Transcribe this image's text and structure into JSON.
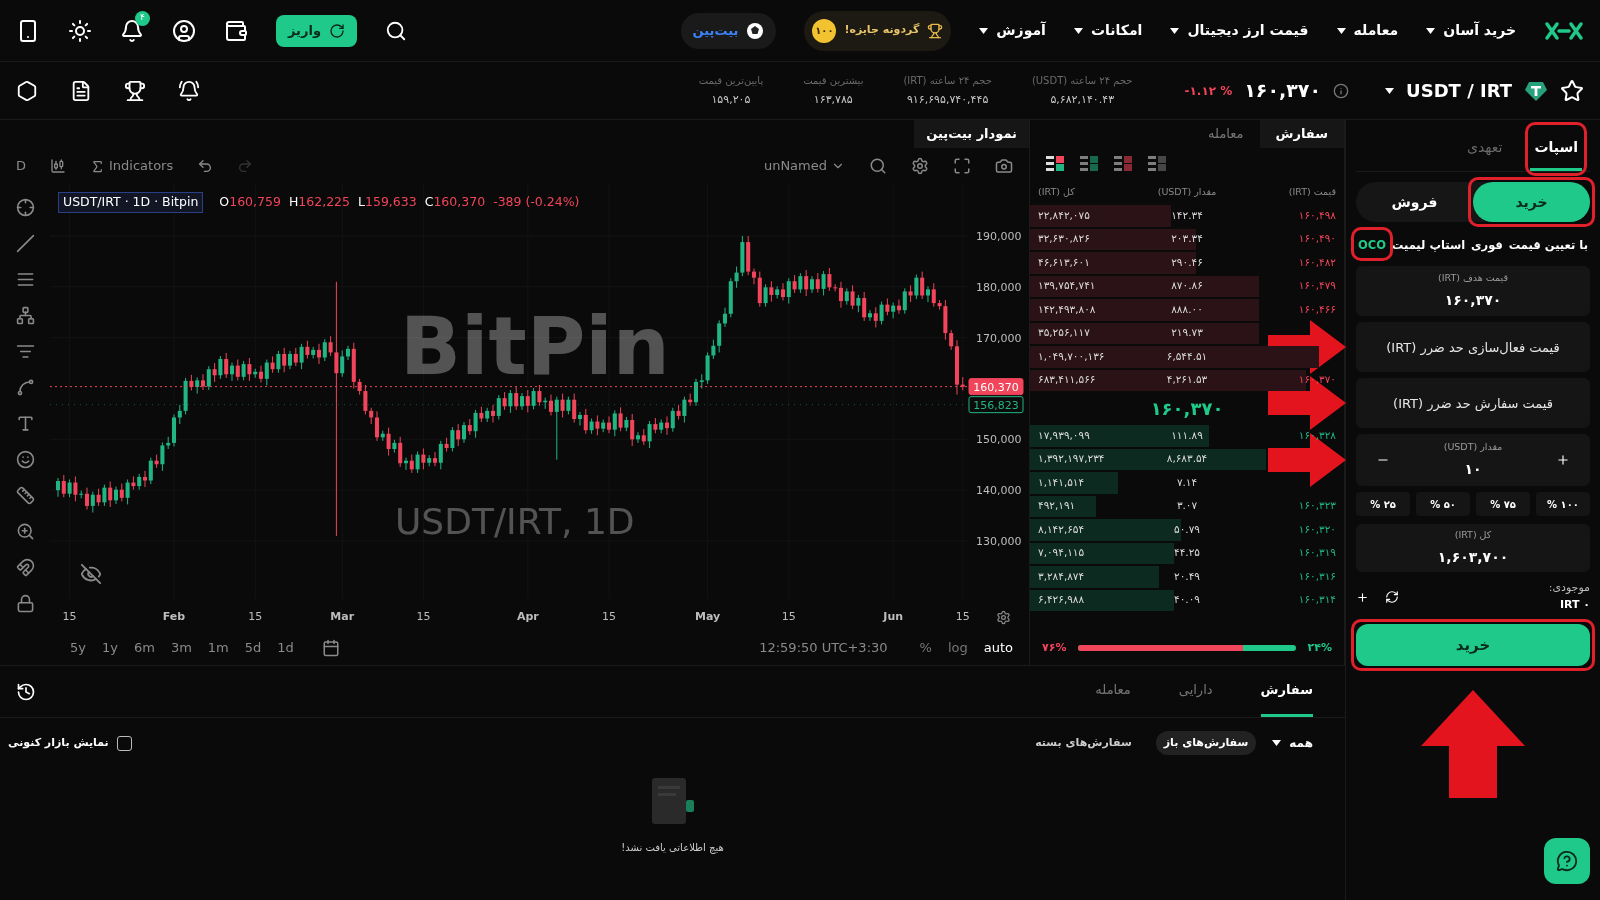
{
  "top_nav": {
    "menu": [
      {
        "label": "خرید آسان"
      },
      {
        "label": "معامله"
      },
      {
        "label": "قیمت ارز دیجیتال"
      },
      {
        "label": "امکانات"
      },
      {
        "label": "آموزش"
      }
    ],
    "prize": {
      "label": "گردونه جایزه!",
      "coin": "۱۰۰"
    },
    "brand_pill": "بیت‌پین",
    "deposit_button": "واریز",
    "notification_count": "۴"
  },
  "market_bar": {
    "pair": "USDT / IRT",
    "favorite": false,
    "price": "۱۶۰,۳۷۰",
    "change": "-۱.۱۲ %",
    "stats": [
      {
        "label": "حجم ۲۴ ساعته (USDT)",
        "value": "۵,۶۸۲,۱۴۰.۴۳"
      },
      {
        "label": "حجم ۲۴ ساعته (IRT)",
        "value": "۹۱۶,۶۹۵,۷۴۰,۴۴۵"
      },
      {
        "label": "بیشترین قیمت",
        "value": "۱۶۳,۷۸۵"
      },
      {
        "label": "پایین‌ترین قیمت",
        "value": "۱۵۹,۲۰۵"
      }
    ]
  },
  "chart": {
    "tab": "نمودار بیت‌پین",
    "interval": "D",
    "indicators_label": "Indicators",
    "layout_name": "unNamed",
    "legend": {
      "symbol": "USDT/IRT · 1D · Bitpin",
      "ohlc": [
        {
          "key": "C",
          "value": "160,370"
        },
        {
          "key": "L",
          "value": "159,633"
        },
        {
          "key": "H",
          "value": "162,225"
        },
        {
          "key": "O",
          "value": "160,759"
        }
      ],
      "change": "-389 (-0.24%)"
    },
    "watermark": [
      "BitPin",
      "USDT/IRT, 1D"
    ],
    "chart_data": {
      "type": "candlestick",
      "categories": [
        null,
        null,
        "15",
        null,
        null,
        null,
        null,
        null,
        null,
        null,
        null,
        null,
        null,
        null,
        null,
        null,
        null,
        null,
        null,
        null,
        "Feb",
        null,
        null,
        null,
        null,
        null,
        null,
        null,
        null,
        null,
        null,
        null,
        null,
        null,
        "15",
        null,
        null,
        null,
        null,
        null,
        null,
        null,
        null,
        null,
        null,
        null,
        null,
        null,
        null,
        "Mar",
        null,
        null,
        null,
        null,
        null,
        null,
        null,
        null,
        null,
        null,
        null,
        null,
        null,
        "15",
        null,
        null,
        null,
        null,
        null,
        null,
        null,
        null,
        null,
        null,
        null,
        null,
        null,
        null,
        null,
        null,
        null,
        "Apr",
        null,
        null,
        null,
        null,
        null,
        null,
        null,
        null,
        null,
        null,
        null,
        null,
        null,
        "15",
        null,
        null,
        null,
        null,
        null,
        null,
        null,
        null,
        null,
        null,
        null,
        null,
        null,
        null,
        null,
        null,
        "May",
        null,
        null,
        null,
        null,
        null,
        null,
        null,
        null,
        null,
        null,
        null,
        null,
        null,
        "15",
        null,
        null,
        null,
        null,
        null,
        null,
        null,
        null,
        null,
        null,
        null,
        null,
        null,
        null,
        null,
        null,
        null,
        "Jun",
        null,
        null,
        null,
        null,
        null,
        null,
        null,
        null,
        null,
        null,
        null,
        "15"
      ],
      "ohlc": [
        [
          140000,
          142400,
          138700,
          141800
        ],
        [
          141800,
          143000,
          138600,
          139300
        ],
        [
          139300,
          142100,
          138600,
          141500
        ],
        [
          141500,
          142700,
          137800,
          139100
        ],
        [
          139100,
          139900,
          138400,
          139300
        ],
        [
          139300,
          140500,
          136200,
          136900
        ],
        [
          136900,
          139700,
          135600,
          139100
        ],
        [
          139100,
          140300,
          136900,
          137600
        ],
        [
          137600,
          141100,
          136900,
          140500
        ],
        [
          140500,
          141700,
          136700,
          138000
        ],
        [
          138000,
          140700,
          137300,
          140100
        ],
        [
          140100,
          141300,
          137800,
          138500
        ],
        [
          138500,
          142100,
          137200,
          141500
        ],
        [
          141500,
          142700,
          140100,
          140800
        ],
        [
          140800,
          143200,
          140100,
          142600
        ],
        [
          142600,
          143800,
          140600,
          141900
        ],
        [
          141900,
          146400,
          141200,
          145800
        ],
        [
          145800,
          147000,
          144400,
          145100
        ],
        [
          145100,
          149400,
          143800,
          148800
        ],
        [
          148800,
          150500,
          148100,
          149300
        ],
        [
          149300,
          154900,
          148600,
          154300
        ],
        [
          154300,
          156800,
          153000,
          155600
        ],
        [
          155600,
          162100,
          154900,
          161500
        ],
        [
          161500,
          162700,
          159600,
          160300
        ],
        [
          160300,
          162200,
          159000,
          161600
        ],
        [
          161600,
          162800,
          159700,
          160400
        ],
        [
          160400,
          164400,
          159700,
          163800
        ],
        [
          163800,
          165000,
          161300,
          162600
        ],
        [
          162600,
          166400,
          161900,
          165800
        ],
        [
          165800,
          167000,
          162100,
          162800
        ],
        [
          162800,
          165100,
          161500,
          164500
        ],
        [
          164500,
          165700,
          161600,
          162300
        ],
        [
          162300,
          165400,
          161600,
          164800
        ],
        [
          164800,
          166000,
          161500,
          162800
        ],
        [
          162800,
          163900,
          162100,
          163300
        ],
        [
          163300,
          164500,
          161200,
          161900
        ],
        [
          161900,
          165700,
          160600,
          165100
        ],
        [
          165100,
          166300,
          163100,
          163800
        ],
        [
          163800,
          167400,
          163100,
          166800
        ],
        [
          166800,
          168000,
          163200,
          164500
        ],
        [
          164500,
          167400,
          163800,
          166800
        ],
        [
          166800,
          168000,
          164400,
          165100
        ],
        [
          165100,
          168800,
          163800,
          168200
        ],
        [
          168200,
          169400,
          165900,
          166600
        ],
        [
          166600,
          168200,
          165900,
          167600
        ],
        [
          167600,
          168800,
          164800,
          166100
        ],
        [
          166100,
          169700,
          165400,
          169100
        ],
        [
          169100,
          170300,
          166400,
          167100
        ],
        [
          167100,
          181000,
          131000,
          163000
        ],
        [
          163000,
          167500,
          162300,
          166300
        ],
        [
          166300,
          168400,
          165600,
          167800
        ],
        [
          167800,
          169000,
          160000,
          161300
        ],
        [
          161300,
          161900,
          158800,
          159500
        ],
        [
          159500,
          160700,
          154900,
          155600
        ],
        [
          155600,
          156200,
          153000,
          154300
        ],
        [
          154300,
          155500,
          149700,
          150400
        ],
        [
          150400,
          151700,
          149700,
          151100
        ],
        [
          151100,
          152300,
          146800,
          148100
        ],
        [
          148100,
          149900,
          147400,
          149300
        ],
        [
          149300,
          150500,
          144600,
          145300
        ],
        [
          145300,
          146400,
          144000,
          145800
        ],
        [
          145800,
          147000,
          143400,
          144100
        ],
        [
          144100,
          147600,
          143400,
          147000
        ],
        [
          147000,
          148200,
          144100,
          145400
        ],
        [
          145400,
          146900,
          144700,
          146300
        ],
        [
          146300,
          147500,
          144700,
          145400
        ],
        [
          145400,
          149700,
          144100,
          149100
        ],
        [
          149100,
          150300,
          147600,
          148300
        ],
        [
          148300,
          152400,
          147600,
          151800
        ],
        [
          151800,
          153000,
          148700,
          150000
        ],
        [
          150000,
          153400,
          149300,
          152800
        ],
        [
          152800,
          154000,
          150900,
          151600
        ],
        [
          151600,
          155800,
          150300,
          155200
        ],
        [
          155200,
          156400,
          153400,
          154100
        ],
        [
          154100,
          156200,
          153400,
          155600
        ],
        [
          155600,
          156800,
          153300,
          154600
        ],
        [
          154600,
          158700,
          153900,
          158100
        ],
        [
          158100,
          159300,
          155800,
          156500
        ],
        [
          156500,
          159700,
          155200,
          159100
        ],
        [
          159100,
          160300,
          155800,
          156500
        ],
        [
          156500,
          159100,
          155800,
          158500
        ],
        [
          158500,
          159700,
          155300,
          156600
        ],
        [
          156600,
          160100,
          155900,
          159500
        ],
        [
          159500,
          160700,
          156600,
          157300
        ],
        [
          157300,
          158200,
          156000,
          157600
        ],
        [
          157600,
          158800,
          154700,
          155400
        ],
        [
          155400,
          158400,
          146000,
          157800
        ],
        [
          157800,
          159000,
          154300,
          155600
        ],
        [
          155600,
          158400,
          154900,
          157800
        ],
        [
          157800,
          159000,
          153300,
          154000
        ],
        [
          154000,
          155400,
          152700,
          154800
        ],
        [
          154800,
          156000,
          151100,
          151800
        ],
        [
          151800,
          154100,
          151100,
          153500
        ],
        [
          153500,
          154700,
          150800,
          152100
        ],
        [
          152100,
          153900,
          151400,
          153300
        ],
        [
          153300,
          154500,
          151200,
          151900
        ],
        [
          151900,
          155700,
          150600,
          155100
        ],
        [
          155100,
          156300,
          151600,
          152300
        ],
        [
          152300,
          154400,
          151600,
          153800
        ],
        [
          153800,
          155000,
          148700,
          150000
        ],
        [
          150000,
          151400,
          149300,
          150800
        ],
        [
          150800,
          152000,
          148900,
          149600
        ],
        [
          149600,
          153600,
          148300,
          153000
        ],
        [
          153000,
          154200,
          151200,
          151900
        ],
        [
          151900,
          153900,
          151200,
          153300
        ],
        [
          153300,
          154500,
          150900,
          152200
        ],
        [
          152200,
          156200,
          151500,
          155600
        ],
        [
          155600,
          156800,
          153900,
          154600
        ],
        [
          154600,
          158400,
          153300,
          157800
        ],
        [
          157800,
          159000,
          156600,
          157300
        ],
        [
          157300,
          161900,
          156600,
          161300
        ],
        [
          161300,
          162800,
          160000,
          161600
        ],
        [
          161600,
          167100,
          160900,
          166500
        ],
        [
          166500,
          169600,
          165800,
          168400
        ],
        [
          168400,
          173400,
          167100,
          172800
        ],
        [
          172800,
          175900,
          172100,
          174700
        ],
        [
          174700,
          181700,
          174000,
          181100
        ],
        [
          181100,
          184000,
          179800,
          182800
        ],
        [
          182800,
          190000,
          182100,
          188800
        ],
        [
          188800,
          190000,
          182300,
          183000
        ],
        [
          183000,
          183600,
          180500,
          181800
        ],
        [
          181800,
          183000,
          176100,
          176800
        ],
        [
          176800,
          180500,
          176100,
          179900
        ],
        [
          179900,
          181100,
          177100,
          178400
        ],
        [
          178400,
          180100,
          177700,
          179500
        ],
        [
          179500,
          180700,
          177300,
          178000
        ],
        [
          178000,
          181700,
          176700,
          181100
        ],
        [
          181100,
          182300,
          178800,
          179500
        ],
        [
          179500,
          182700,
          178800,
          182100
        ],
        [
          182100,
          183300,
          178200,
          179500
        ],
        [
          179500,
          182100,
          178800,
          181500
        ],
        [
          181500,
          182700,
          178900,
          179600
        ],
        [
          179600,
          183100,
          178300,
          182500
        ],
        [
          182500,
          183700,
          179200,
          179900
        ],
        [
          179900,
          180500,
          179100,
          179800
        ],
        [
          179800,
          181000,
          175900,
          177200
        ],
        [
          177200,
          179700,
          176500,
          179100
        ],
        [
          179100,
          180300,
          175600,
          176300
        ],
        [
          176300,
          178400,
          175000,
          177800
        ],
        [
          177800,
          179000,
          173300,
          174000
        ],
        [
          174000,
          175400,
          173300,
          174800
        ],
        [
          174800,
          176000,
          172000,
          173300
        ],
        [
          173300,
          177100,
          172600,
          176500
        ],
        [
          176500,
          177700,
          174400,
          175100
        ],
        [
          175100,
          176900,
          173800,
          176300
        ],
        [
          176300,
          177500,
          174700,
          175400
        ],
        [
          175400,
          179700,
          174700,
          179100
        ],
        [
          179100,
          180300,
          177000,
          178300
        ],
        [
          178300,
          182400,
          177600,
          181800
        ],
        [
          181800,
          183000,
          177600,
          178300
        ],
        [
          178300,
          180100,
          177000,
          179500
        ],
        [
          179500,
          180700,
          176100,
          176800
        ],
        [
          176800,
          177400,
          175500,
          176200
        ],
        [
          176200,
          177400,
          169600,
          170900
        ],
        [
          170900,
          171500,
          167600,
          168300
        ],
        [
          168300,
          169500,
          158800,
          160759
        ],
        [
          160759,
          162225,
          159633,
          160370
        ]
      ],
      "ylim": [
        118590,
        200230
      ],
      "yticks": [
        {
          "value": 190000,
          "label": "190,000"
        },
        {
          "value": 180000,
          "label": "180,000"
        },
        {
          "value": 170000,
          "label": "170,000"
        },
        {
          "value": 150000,
          "label": "150,000"
        },
        {
          "value": 140000,
          "label": "140,000"
        },
        {
          "value": 130000,
          "label": "130,000"
        }
      ],
      "grid": true,
      "ref_lines": [
        {
          "axis": "y",
          "value": 160370,
          "label": "160,370",
          "color": "#f0455a"
        },
        {
          "axis": "y",
          "value": 156823,
          "label": "156,823",
          "color": "#22b584"
        }
      ]
    },
    "ranges": [
      "1d",
      "5d",
      "1m",
      "3m",
      "6m",
      "1y",
      "5y"
    ],
    "clock": "12:59:50 UTC+3:30",
    "scale_options": [
      {
        "label": "auto",
        "selected": true
      },
      {
        "label": "log",
        "selected": false
      },
      {
        "label": "%",
        "selected": false
      }
    ]
  },
  "order_book": {
    "tabs": [
      {
        "label": "سفارش",
        "selected": true
      },
      {
        "label": "معامله",
        "selected": false
      }
    ],
    "views": [
      {
        "kind": "both",
        "selected": true
      },
      {
        "kind": "bids",
        "selected": false
      },
      {
        "kind": "asks",
        "selected": false
      },
      {
        "kind": "grid",
        "selected": false
      }
    ],
    "columns": [
      "قیمت (IRT)",
      "مقدار (USDT)",
      "کل (IRT)"
    ],
    "asks": [
      {
        "price": "۱۶۰,۴۹۸",
        "amount": "۱۴۲.۳۴",
        "total": "۲۲,۸۴۲,۰۷۵"
      },
      {
        "price": "۱۶۰,۴۹۰",
        "amount": "۲۰۳.۳۴",
        "total": "۳۲,۶۳۰,۸۲۶"
      },
      {
        "price": "۱۶۰,۴۸۲",
        "amount": "۲۹۰.۴۶",
        "total": "۴۶,۶۱۳,۶۰۱"
      },
      {
        "price": "۱۶۰,۴۷۹",
        "amount": "۸۷۰.۸۶",
        "total": "۱۳۹,۷۵۴,۷۴۱"
      },
      {
        "price": "۱۶۰,۴۶۶",
        "amount": "۸۸۸.۰۰",
        "total": "۱۴۲,۴۹۳,۸۰۸"
      },
      {
        "amount": "۲۱۹.۷۳",
        "total": "۳۵,۲۵۶,۱۱۷"
      },
      {
        "amount": "۶,۵۴۴.۵۱",
        "total": "۱,۰۴۹,۷۰۰,۱۳۶"
      },
      {
        "price": "۱۶۰,۳۷۰",
        "amount": "۴,۲۶۱.۵۳",
        "total": "۶۸۳,۴۱۱,۵۶۶"
      }
    ],
    "mid_price": "۱۶۰,۳۷۰",
    "bids": [
      {
        "price": "۱۶۰,۳۲۸",
        "amount": "۱۱۱.۸۹",
        "total": "۱۷,۹۳۹,۰۹۹"
      },
      {
        "amount": "۸,۶۸۳.۵۴",
        "total": "۱,۳۹۲,۱۹۷,۲۳۴"
      },
      {
        "amount": "۷.۱۴",
        "total": "۱,۱۴۱,۵۱۴"
      },
      {
        "price": "۱۶۰,۳۲۳",
        "amount": "۳.۰۷",
        "total": "۴۹۲,۱۹۱"
      },
      {
        "price": "۱۶۰,۳۲۰",
        "amount": "۵۰.۷۹",
        "total": "۸,۱۴۲,۶۵۴"
      },
      {
        "price": "۱۶۰,۳۱۹",
        "amount": "۴۴.۲۵",
        "total": "۷,۰۹۴,۱۱۵"
      },
      {
        "price": "۱۶۰,۳۱۶",
        "amount": "۲۰.۴۹",
        "total": "۳,۲۸۴,۸۷۴"
      },
      {
        "price": "۱۶۰,۳۱۴",
        "amount": "۴۰.۰۹",
        "total": "۶,۴۲۶,۹۸۸"
      }
    ],
    "ratio": {
      "sell": "۷۶%",
      "buy": "۲۴%",
      "level": 0.76
    }
  },
  "order_form": {
    "tabs": [
      {
        "label": "اسپات",
        "selected": true,
        "highlighted": true
      },
      {
        "label": "تعهدی",
        "selected": false,
        "highlighted": false
      }
    ],
    "sides": [
      {
        "label": "خرید",
        "selected": true,
        "highlighted": true
      },
      {
        "label": "فروش",
        "selected": false,
        "highlighted": false
      }
    ],
    "order_types": [
      {
        "label": "با تعیین قیمت",
        "selected": false,
        "highlighted": false
      },
      {
        "label": "فوری",
        "selected": false,
        "highlighted": false
      },
      {
        "label": "استاپ لیمیت",
        "selected": false,
        "highlighted": false
      },
      {
        "label": "OCO",
        "selected": true,
        "highlighted": true
      }
    ],
    "fields": [
      {
        "kind": "value",
        "label": "قیمت هدف (IRT)",
        "value": "۱۶۰,۳۷۰",
        "pointer_arrow": false
      },
      {
        "kind": "input",
        "placeholder": "قیمت فعال‌سازی حد ضرر (IRT)",
        "pointer_arrow": true
      },
      {
        "kind": "input",
        "placeholder": "قیمت سفارش حد ضرر (IRT)",
        "pointer_arrow": true
      },
      {
        "kind": "stepper",
        "label": "مقدار (USDT)",
        "value": "۱۰",
        "pointer_arrow": true
      }
    ],
    "percents": [
      "۱۰۰ %",
      "۷۵ %",
      "۵۰ %",
      "۲۵ %"
    ],
    "total": {
      "label": "کل (IRT)",
      "value": "۱,۶۰۳,۷۰۰"
    },
    "balance": {
      "label": "موجودی:",
      "value": "IRT ۰"
    },
    "submit": {
      "label": "خرید",
      "highlighted": true,
      "pointer_arrow": true
    }
  },
  "bottom_panel": {
    "tabs": [
      {
        "label": "سفارش",
        "selected": true
      },
      {
        "label": "دارایی",
        "selected": false
      },
      {
        "label": "معامله",
        "selected": false
      }
    ],
    "filter": "همه",
    "status_tabs": [
      {
        "label": "سفارش‌های باز",
        "selected": true
      },
      {
        "label": "سفارش‌های بسته",
        "selected": false
      }
    ],
    "current_market": {
      "label": "نمایش بازار کنونی",
      "checked": false
    },
    "empty_message": "هیچ اطلاعاتی یافت نشد!"
  }
}
